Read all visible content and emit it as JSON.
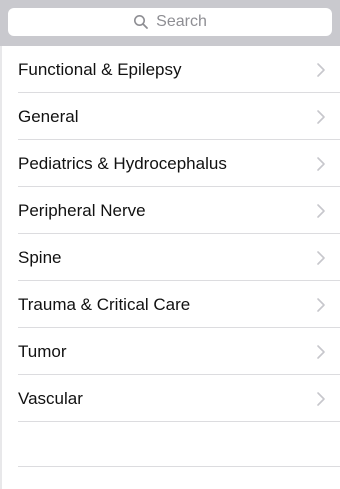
{
  "search": {
    "placeholder": "Search",
    "icon": "search-icon"
  },
  "list": {
    "items": [
      {
        "label": "Functional & Epilepsy",
        "icon": "chevron-right-icon"
      },
      {
        "label": "General",
        "icon": "chevron-right-icon"
      },
      {
        "label": "Pediatrics & Hydrocephalus",
        "icon": "chevron-right-icon"
      },
      {
        "label": "Peripheral Nerve",
        "icon": "chevron-right-icon"
      },
      {
        "label": "Spine",
        "icon": "chevron-right-icon"
      },
      {
        "label": "Trauma & Critical Care",
        "icon": "chevron-right-icon"
      },
      {
        "label": "Tumor",
        "icon": "chevron-right-icon"
      },
      {
        "label": "Vascular",
        "icon": "chevron-right-icon"
      }
    ]
  },
  "colors": {
    "search_bar_background": "#c9c9ce",
    "separator": "#dcdcdf",
    "chevron": "#c7c7cc",
    "text": "#111111",
    "placeholder": "#8e8e93"
  }
}
